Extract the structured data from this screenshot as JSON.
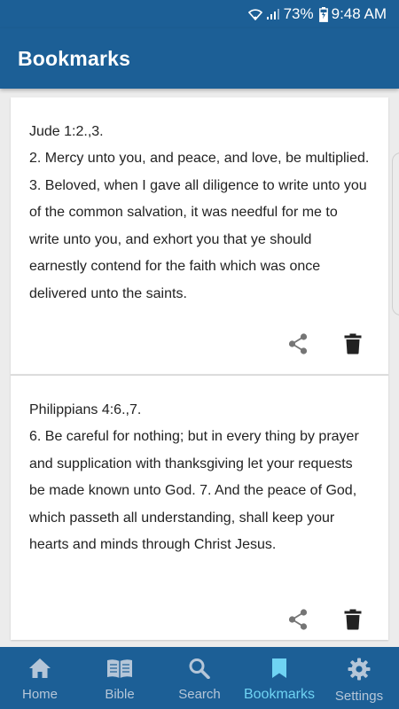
{
  "status_bar": {
    "battery": "73%",
    "time": "9:48 AM"
  },
  "header": {
    "title": "Bookmarks"
  },
  "bookmarks": [
    {
      "reference": "Jude 1:2.,3.",
      "text": "2. Mercy unto you, and peace, and love, be multiplied. 3. Beloved, when I gave all diligence to write unto you of the common salvation, it was needful for me to write unto you, and exhort you that ye should earnestly contend for the faith which was once delivered unto the saints."
    },
    {
      "reference": "Philippians 4:6.,7.",
      "text": "6. Be careful for nothing; but in every thing by prayer and supplication with thanksgiving let your requests be made known unto God. 7. And the peace of God, which passeth all understanding, shall keep your hearts and minds through Christ Jesus."
    }
  ],
  "bottom_nav": {
    "items": [
      {
        "label": "Home",
        "icon": "home-icon"
      },
      {
        "label": "Bible",
        "icon": "book-icon"
      },
      {
        "label": "Search",
        "icon": "search-icon"
      },
      {
        "label": "Bookmarks",
        "icon": "bookmark-icon"
      },
      {
        "label": "Settings",
        "icon": "gear-icon"
      }
    ],
    "active": "Bookmarks"
  },
  "colors": {
    "primary": "#1c5f96",
    "active_tab": "#6fd3f3",
    "inactive_tab": "#b5c6d8"
  }
}
